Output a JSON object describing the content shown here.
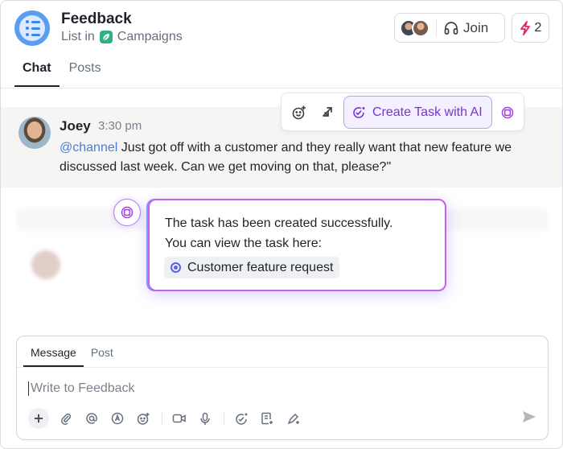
{
  "header": {
    "title": "Feedback",
    "subtitle_prefix": "List in",
    "location": "Campaigns",
    "join_label": "Join",
    "automations_count": "2"
  },
  "tabs": [
    {
      "label": "Chat",
      "active": true
    },
    {
      "label": "Posts",
      "active": false
    }
  ],
  "message": {
    "author": "Joey",
    "time": "3:30 pm",
    "mention": "@channel",
    "text": " Just got off with a customer and they really want that new feature we discussed last week. Can we get moving on that, please?\""
  },
  "message_toolbar": {
    "ai_button_label": "Create Task with AI"
  },
  "ai_popup": {
    "line1": "The task has been created successfully.",
    "line2": "You can view the task here:",
    "task_name": "Customer feature request"
  },
  "composer": {
    "tabs": [
      {
        "label": "Message",
        "active": true
      },
      {
        "label": "Post",
        "active": false
      }
    ],
    "placeholder": "Write to Feedback"
  },
  "colors": {
    "accent_purple": "#7a33d6",
    "popup_border": "#c064e8",
    "mention_blue": "#4a7cd6",
    "list_icon_blue": "#5b9df0",
    "bolt_pink": "#e0245e"
  }
}
